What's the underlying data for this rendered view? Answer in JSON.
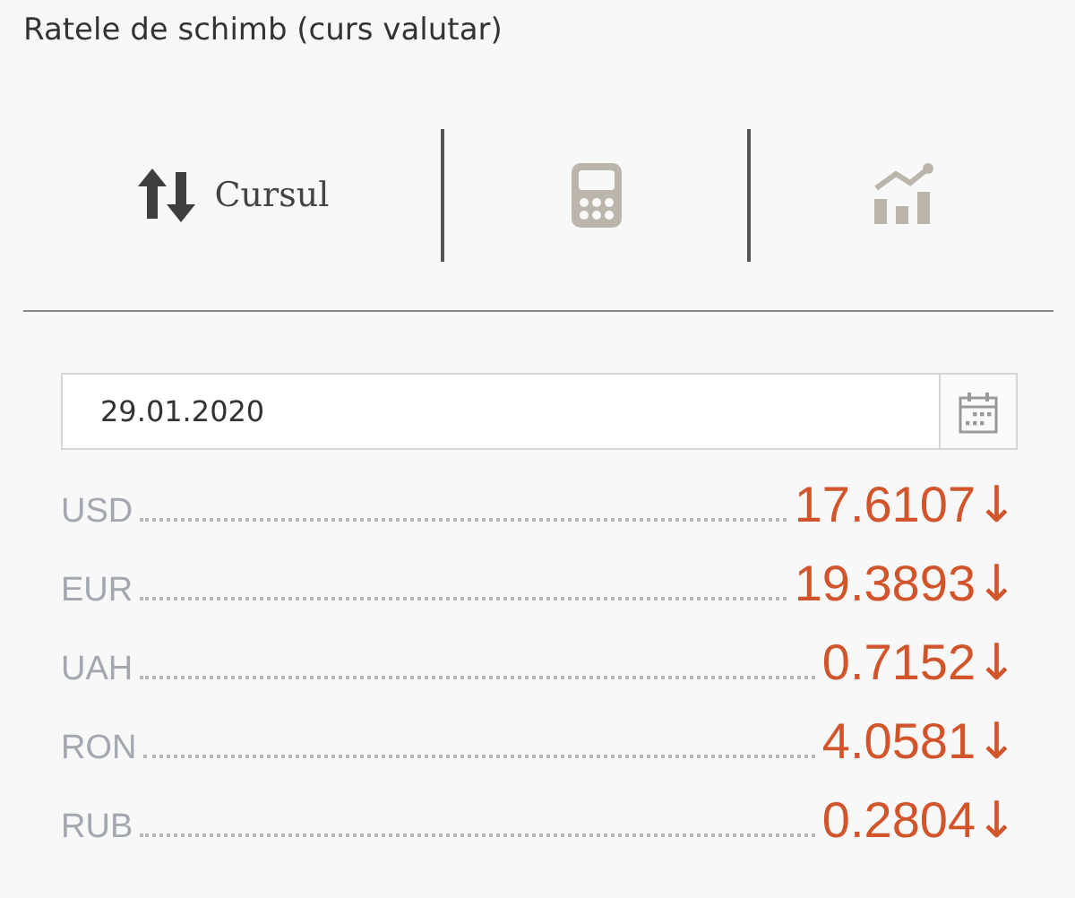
{
  "title": "Ratele de schimb (curs valutar)",
  "tabs": [
    {
      "kind": "rates",
      "label": "Cursul",
      "selected": true
    },
    {
      "kind": "calculator",
      "selected": false
    },
    {
      "kind": "chart",
      "selected": false
    }
  ],
  "date_field": {
    "value": "29.01.2020"
  },
  "rates": [
    {
      "currency": "USD",
      "value": "17.6107",
      "trend": "↓"
    },
    {
      "currency": "EUR",
      "value": "19.3893",
      "trend": "↓"
    },
    {
      "currency": "UAH",
      "value": "0.7152",
      "trend": "↓"
    },
    {
      "currency": "RON",
      "value": "4.0581",
      "trend": "↓"
    },
    {
      "currency": "RUB",
      "value": "0.2804",
      "trend": "↓"
    }
  ]
}
